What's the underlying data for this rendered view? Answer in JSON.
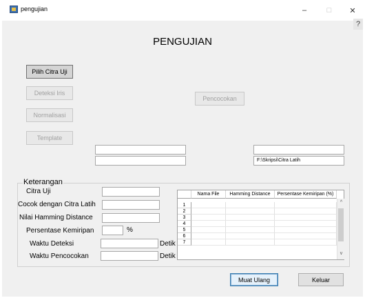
{
  "window": {
    "title": "pengujian",
    "minimize": "–",
    "maximize": "□",
    "close": "✕",
    "help": "?"
  },
  "heading": "PENGUJIAN",
  "buttons": {
    "pilih": "Pilih Citra Uji",
    "deteksi": "Deteksi Iris",
    "normalisasi": "Normalisasi",
    "template": "Template",
    "pencocokan": "Pencocokan",
    "muat_ulang": "Muat Ulang",
    "keluar": "Keluar"
  },
  "fields": {
    "left_top": "",
    "left_bottom": "",
    "right_top": "",
    "right_bottom": "F:\\Skripsi\\Citra Latih"
  },
  "keterangan": {
    "title": "Keterangan",
    "citra_uji": {
      "label": "Citra Uji",
      "value": ""
    },
    "cocok": {
      "label": "Cocok dengan Citra Latih",
      "value": ""
    },
    "hamming": {
      "label": "Nilai Hamming Distance",
      "value": ""
    },
    "persentase": {
      "label": "Persentase Kemiripan",
      "value": "",
      "unit": "%"
    },
    "waktu_deteksi": {
      "label": "Waktu Deteksi",
      "value": "",
      "unit": "Detik"
    },
    "waktu_pencocokan": {
      "label": "Waktu Pencocokan",
      "value": "",
      "unit": "Detik"
    }
  },
  "table": {
    "columns": [
      "Nama File",
      "Hamming Distance",
      "Persentase Kemiripan (%)"
    ],
    "rows": [
      "1",
      "2",
      "3",
      "4",
      "5",
      "6",
      "7"
    ]
  },
  "icons": {
    "scroll_up": "up-arrow-icon",
    "scroll_down": "down-arrow-icon",
    "app": "app-icon"
  }
}
